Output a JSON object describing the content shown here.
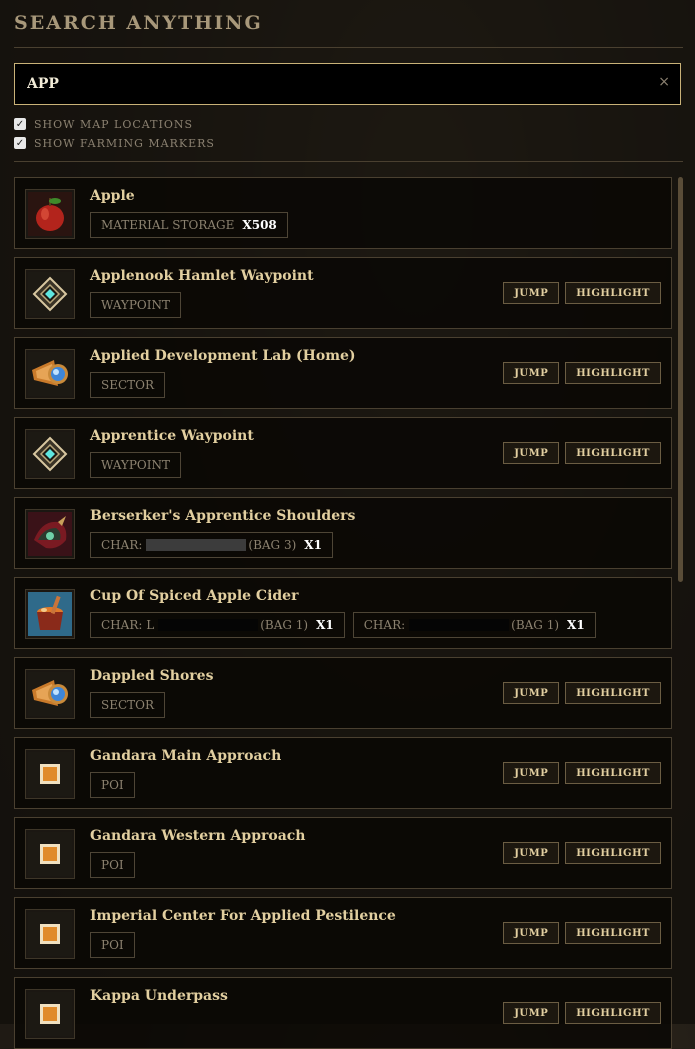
{
  "header": {
    "title": "SEARCH ANYTHING"
  },
  "search": {
    "value": "APP",
    "clear_label": "×"
  },
  "options": [
    {
      "label": "SHOW MAP LOCATIONS",
      "checked": true
    },
    {
      "label": "SHOW FARMING MARKERS",
      "checked": true
    }
  ],
  "buttons": {
    "jump": "JUMP",
    "highlight": "HIGHLIGHT"
  },
  "results": [
    {
      "name": "Apple",
      "icon": "apple-icon",
      "tags": [
        {
          "kind": "storage",
          "label": "MATERIAL STORAGE",
          "qty": "X508"
        }
      ],
      "actions": false
    },
    {
      "name": "Applenook Hamlet Waypoint",
      "icon": "waypoint-icon",
      "tags": [
        {
          "kind": "plain",
          "label": "WAYPOINT"
        }
      ],
      "actions": true
    },
    {
      "name": "Applied Development Lab (Home)",
      "icon": "sector-icon",
      "tags": [
        {
          "kind": "plain",
          "label": "SECTOR"
        }
      ],
      "actions": true
    },
    {
      "name": "Apprentice Waypoint",
      "icon": "waypoint-icon",
      "tags": [
        {
          "kind": "plain",
          "label": "WAYPOINT"
        }
      ],
      "actions": true
    },
    {
      "name": "Berserker's Apprentice Shoulders",
      "icon": "shoulders-icon",
      "tags": [
        {
          "kind": "char",
          "label": "CHAR:",
          "bag": "(BAG 3)",
          "qty": "X1"
        }
      ],
      "actions": false
    },
    {
      "name": "Cup Of Spiced Apple Cider",
      "icon": "cider-icon",
      "tags": [
        {
          "kind": "char",
          "label": "CHAR: l",
          "bag": "(BAG 1)",
          "qty": "X1",
          "dark": true
        },
        {
          "kind": "char",
          "label": "CHAR: ",
          "bag": "(BAG 1)",
          "qty": "X1",
          "dark": true
        }
      ],
      "actions": false
    },
    {
      "name": "Dappled Shores",
      "icon": "sector-icon",
      "tags": [
        {
          "kind": "plain",
          "label": "SECTOR"
        }
      ],
      "actions": true
    },
    {
      "name": "Gandara Main Approach",
      "icon": "poi-icon",
      "tags": [
        {
          "kind": "plain",
          "label": "POI"
        }
      ],
      "actions": true
    },
    {
      "name": "Gandara Western Approach",
      "icon": "poi-icon",
      "tags": [
        {
          "kind": "plain",
          "label": "POI"
        }
      ],
      "actions": true
    },
    {
      "name": "Imperial Center For Applied Pestilence",
      "icon": "poi-icon",
      "tags": [
        {
          "kind": "plain",
          "label": "POI"
        }
      ],
      "actions": true
    },
    {
      "name": "Kappa Underpass",
      "icon": "poi-icon",
      "tags": [],
      "actions": true
    }
  ]
}
